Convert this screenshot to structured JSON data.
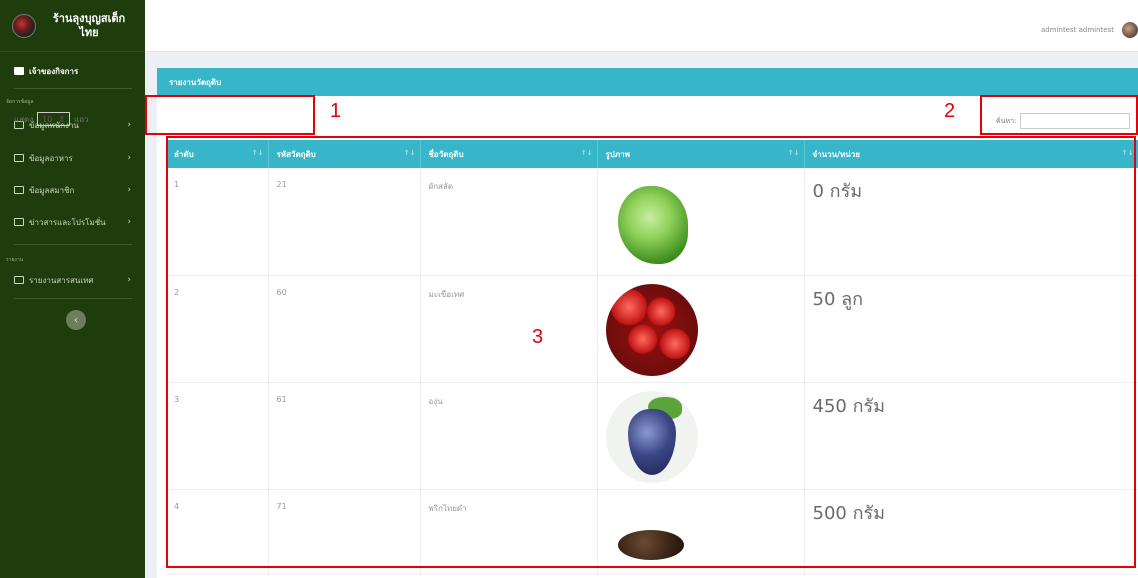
{
  "sidebar": {
    "brand_title": "ร้านลุงบุญสเต็กไทย",
    "items": [
      {
        "label": "เจ้าของกิจการ",
        "icon": "id-card-icon"
      },
      {
        "label": "ข้อมูลพนักงาน",
        "icon": "list-icon"
      },
      {
        "label": "ข้อมูลอาหาร",
        "icon": "food-icon"
      },
      {
        "label": "ข้อมูลสมาชิก",
        "icon": "users-icon"
      },
      {
        "label": "ข่าวสารและโปรโมชั่น",
        "icon": "megaphone-icon"
      },
      {
        "label": "รายงานสารสนเทศ",
        "icon": "folder-icon"
      }
    ],
    "section_data": "จัดการข้อมูล",
    "section_report": "รายงาน",
    "collapse_label": "‹"
  },
  "topbar": {
    "user_name": "admintest admintest"
  },
  "panel": {
    "title": "รายงานวัตถุดิบ",
    "show_prefix": "แสดง",
    "show_value": "10",
    "show_suffix": "แถว",
    "search_label": "ค้นหา:"
  },
  "table": {
    "headers": [
      "ลำดับ",
      "รหัสวัตถุดิบ",
      "ชื่อวัตถุดิบ",
      "รูปภาพ",
      "จำนวน/หน่วย"
    ],
    "rows": [
      {
        "no": "1",
        "code": "21",
        "name": "ผักสลัด",
        "image": "lettuce",
        "qty": "0 กรัม"
      },
      {
        "no": "2",
        "code": "60",
        "name": "มะเขือเทศ",
        "image": "tomato",
        "qty": "50 ลูก"
      },
      {
        "no": "3",
        "code": "61",
        "name": "องุ่น",
        "image": "grape",
        "qty": "450 กรัม"
      },
      {
        "no": "4",
        "code": "71",
        "name": "พริกไทยดำ",
        "image": "black-pepper",
        "qty": "500 กรัม"
      }
    ]
  },
  "annotations": [
    {
      "label": "1",
      "color": "#e3000b"
    },
    {
      "label": "2",
      "color": "#e3000b"
    },
    {
      "label": "3",
      "color": "#e3000b"
    }
  ],
  "colors": {
    "sidebar_bg": "#1f3d0c",
    "accent": "#37b6c9",
    "annotation": "#e3000b"
  }
}
